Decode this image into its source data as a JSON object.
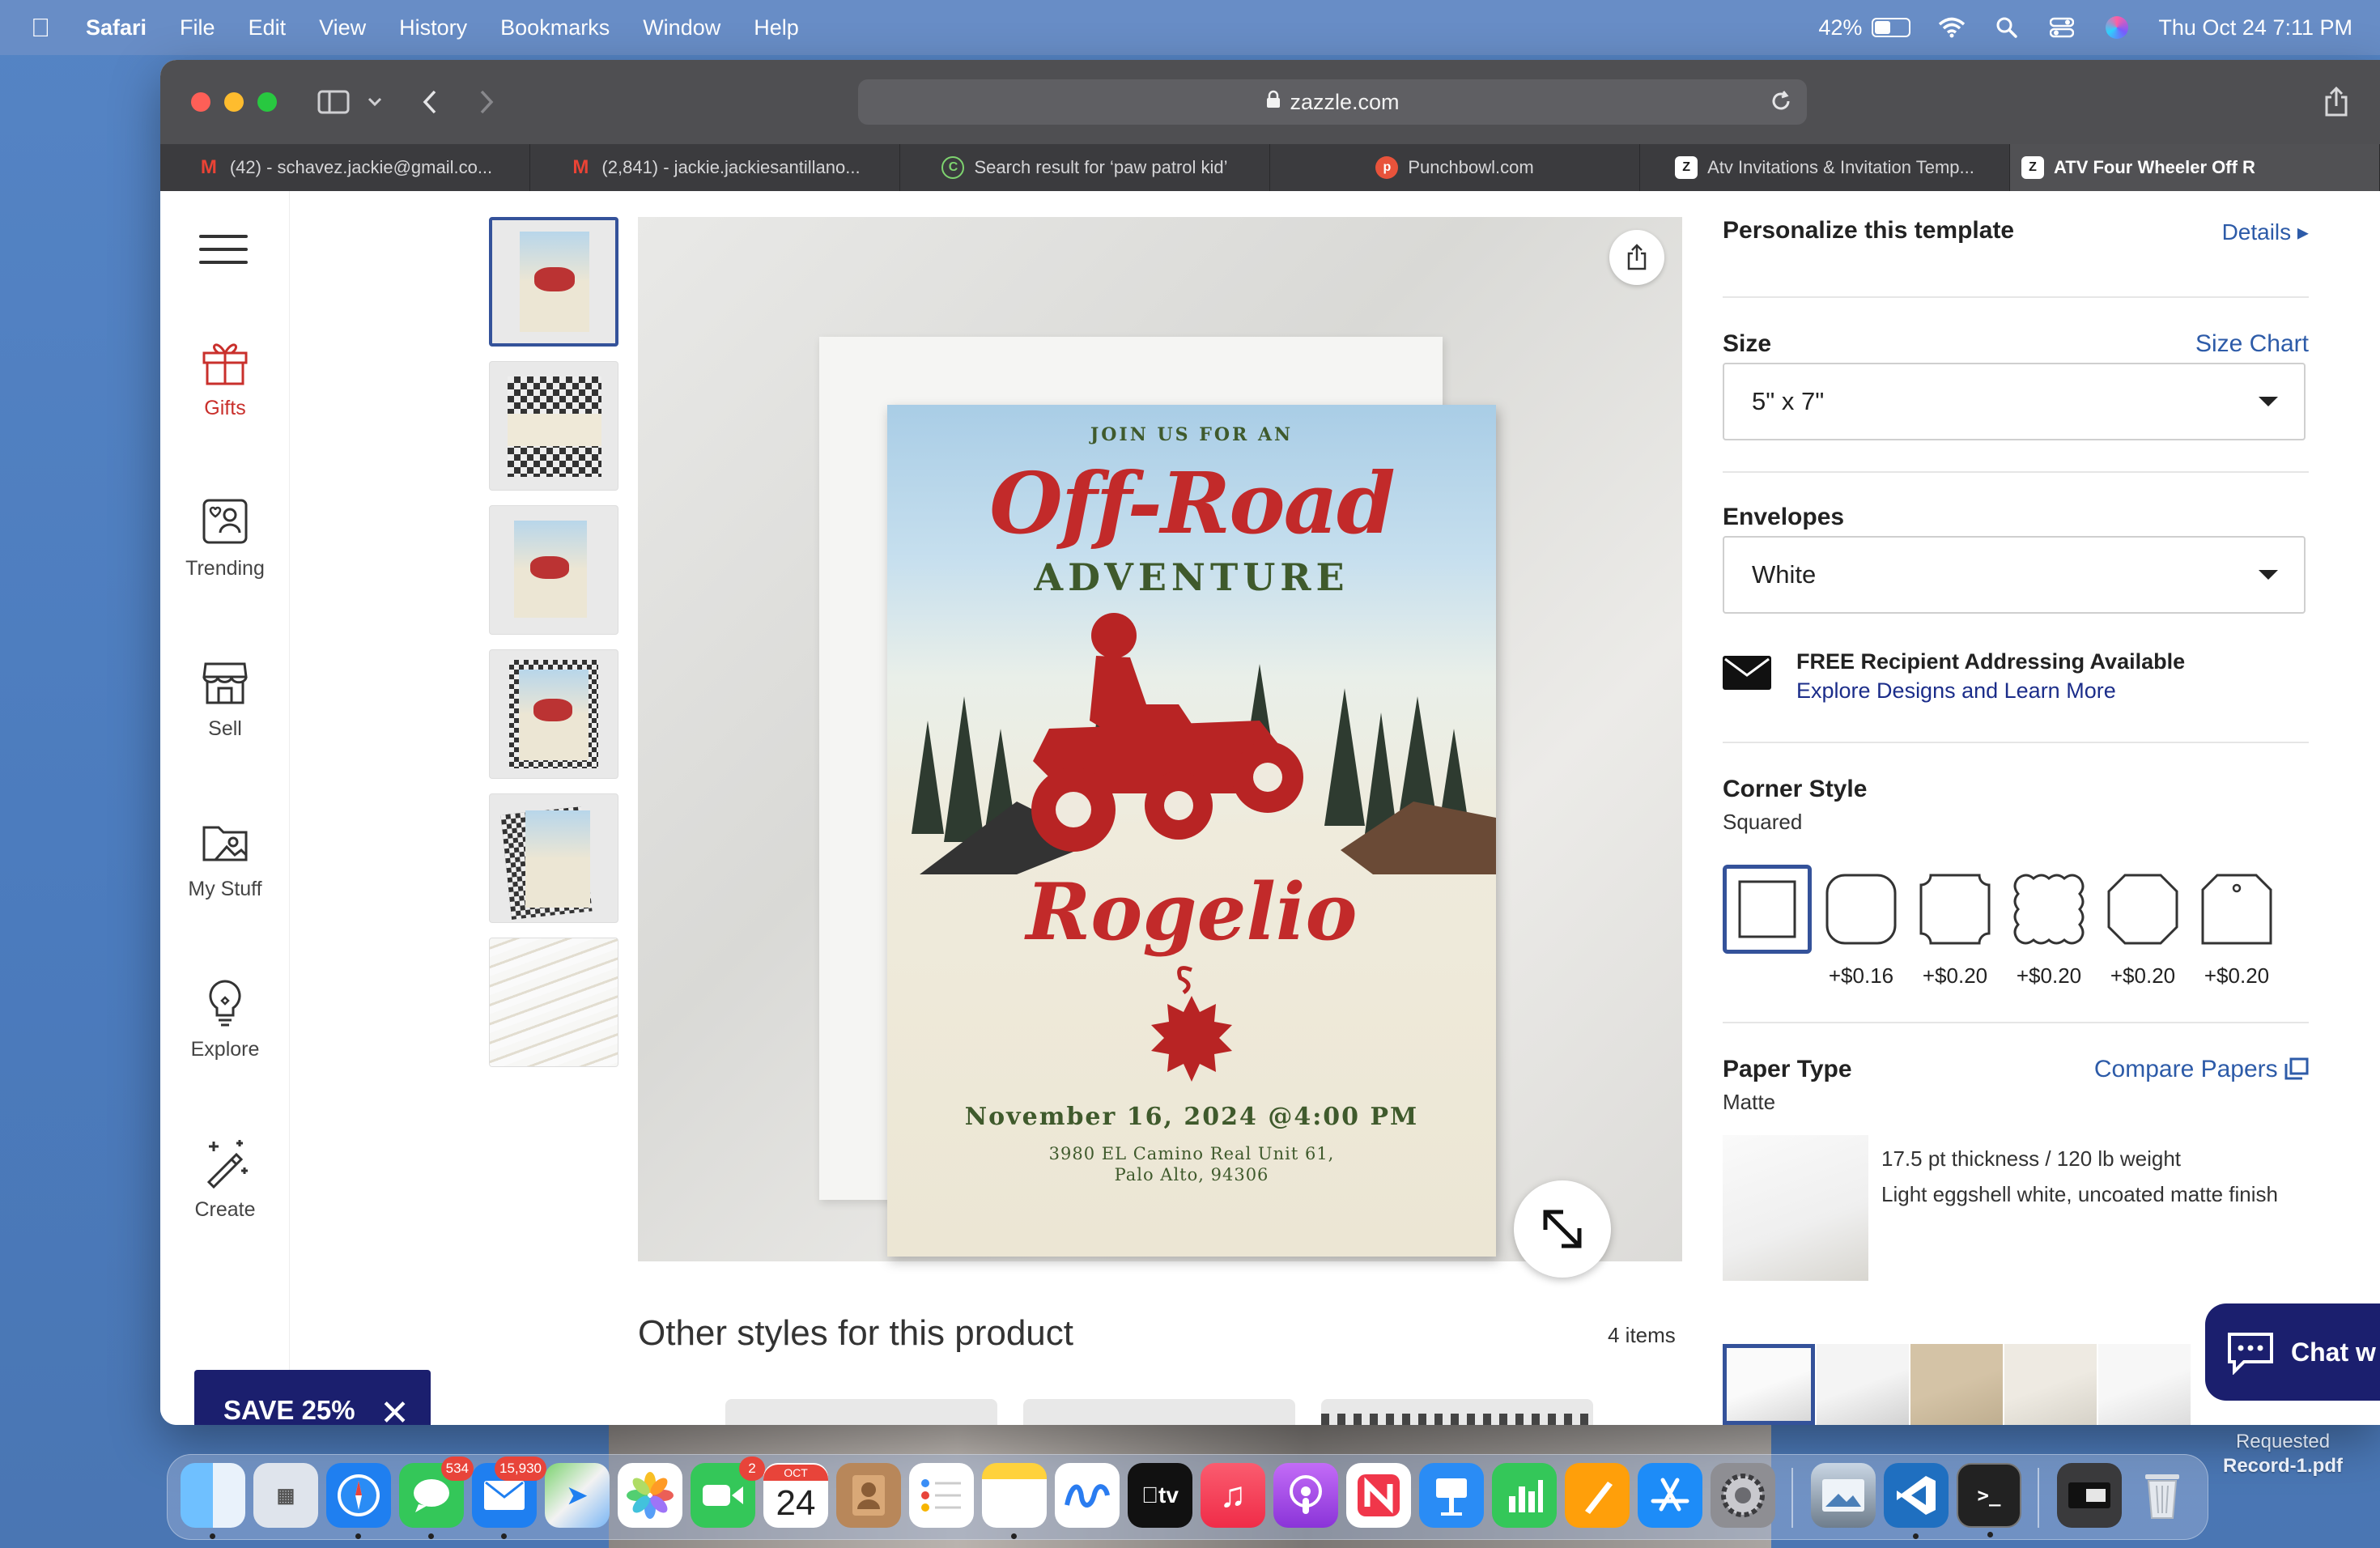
{
  "menubar": {
    "app_name": "Safari",
    "items": [
      "File",
      "Edit",
      "View",
      "History",
      "Bookmarks",
      "Window",
      "Help"
    ],
    "battery_percent": "42%",
    "battery_level": 0.42,
    "datetime": "Thu Oct 24  7:11 PM"
  },
  "browser": {
    "url": "zazzle.com",
    "tabs": [
      {
        "label": "(42) - schavez.jackie@gmail.co...",
        "icon": "gmail-icon"
      },
      {
        "label": "(2,841) - jackie.jackiesantillano...",
        "icon": "gmail-icon"
      },
      {
        "label": "Search result for ‘paw patrol kid’",
        "icon": "canva-icon"
      },
      {
        "label": "Punchbowl.com",
        "icon": "punchbowl-icon"
      },
      {
        "label": "Atv Invitations & Invitation Temp...",
        "icon": "zazzle-icon"
      },
      {
        "label": "ATV Four Wheeler Off R",
        "icon": "zazzle-icon",
        "active": true
      }
    ]
  },
  "leftnav": {
    "items": [
      {
        "label": "Gifts",
        "icon": "gift-icon"
      },
      {
        "label": "Trending",
        "icon": "trending-icon"
      },
      {
        "label": "Sell",
        "icon": "store-icon"
      },
      {
        "label": "My Stuff",
        "icon": "folder-icon"
      },
      {
        "label": "Explore",
        "icon": "lightbulb-icon"
      },
      {
        "label": "Create",
        "icon": "create-wand-icon"
      }
    ],
    "save_label": "SAVE 25%"
  },
  "product": {
    "card": {
      "join": "JOIN US FOR AN",
      "title": "Off-Road",
      "subtitle": "ADVENTURE",
      "name": "Rogelio",
      "date": "November 16, 2024 @4:00 PM",
      "address_line1": "3980 EL Camino Real Unit 61,",
      "address_line2": "Palo Alto, 94306"
    },
    "other_styles_title": "Other styles for this product",
    "other_styles_count": "4 items"
  },
  "panel": {
    "title": "Personalize this template",
    "details_link": "Details",
    "size_label": "Size",
    "size_chart_link": "Size Chart",
    "size_value": "5\" x 7\"",
    "envelopes_label": "Envelopes",
    "envelopes_value": "White",
    "free_addressing": "FREE Recipient Addressing Available",
    "explore_link": "Explore Designs and Learn More",
    "corner_label": "Corner Style",
    "corner_value": "Squared",
    "corner_prices": [
      "",
      "+$0.16",
      "+$0.20",
      "+$0.20",
      "+$0.20",
      "+$0.20"
    ],
    "paper_label": "Paper Type",
    "compare_link": "Compare Papers",
    "paper_value": "Matte",
    "paper_desc1": "17.5 pt thickness / 120 lb weight",
    "paper_desc2": "Light eggshell white, uncoated matte finish",
    "chat_label": "Chat w"
  },
  "dock": {
    "messages_badge": "534",
    "mail_badge": "15,930",
    "facetime_badge": "2",
    "calendar_month": "OCT",
    "calendar_day": "24",
    "apple_tv_label": "tv"
  },
  "desktop": {
    "file_line1": "Requested",
    "file_line2": "Record-1.pdf"
  },
  "colors": {
    "brand_navy": "#1b1f6e",
    "link_blue": "#2d5ba8",
    "selection_blue": "#34529a",
    "gifts_red": "#c9302c",
    "card_red": "#c22a2a",
    "card_green": "#3f5a2c"
  }
}
